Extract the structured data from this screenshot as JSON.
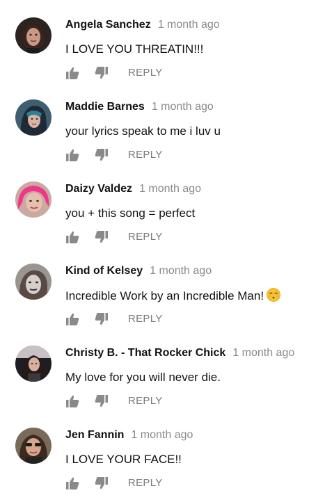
{
  "comments": [
    {
      "author": "Angela Sanchez",
      "time": "1 month ago",
      "text": "I LOVE YOU THREATIN!!!",
      "reply_label": "REPLY",
      "avatar_color": "#3b2c2a"
    },
    {
      "author": "Maddie Barnes",
      "time": "1 month ago",
      "text": "your lyrics speak to me i luv u",
      "reply_label": "REPLY",
      "avatar_color": "#4a6b7e"
    },
    {
      "author": "Daizy Valdez",
      "time": "1 month ago",
      "text": "you + this song = perfect",
      "reply_label": "REPLY",
      "avatar_color": "#e04a8f"
    },
    {
      "author": "Kind of Kelsey",
      "time": "1 month ago",
      "text": "Incredible Work by an Incredible Man!",
      "emoji": "smiling-kissing-emoji",
      "reply_label": "REPLY",
      "avatar_color": "#8e8a86"
    },
    {
      "author": "Christy B. - That Rocker Chick",
      "time": "1 month ago",
      "text": "My love for you will never die.",
      "reply_label": "REPLY",
      "avatar_color": "#2a2a2e"
    },
    {
      "author": "Jen Fannin",
      "time": "1 month ago",
      "text": "I LOVE YOUR FACE!!",
      "reply_label": "REPLY",
      "avatar_color": "#6a4e3e"
    }
  ],
  "icons": {
    "like": "thumbs-up-icon",
    "dislike": "thumbs-down-icon"
  },
  "colors": {
    "author": "#111111",
    "time": "#8a8a8a",
    "icon": "#8a8a8a",
    "reply": "#7a7a7a"
  }
}
